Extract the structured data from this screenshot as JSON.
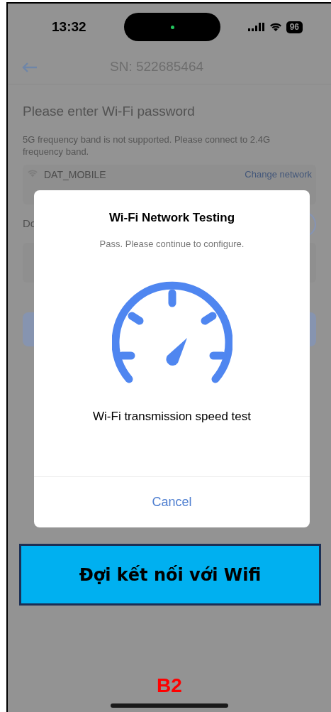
{
  "status_bar": {
    "time": "13:32",
    "battery": "96"
  },
  "header": {
    "title": "SN: 522685464"
  },
  "page": {
    "heading": "Please enter Wi-Fi password",
    "note": "5G frequency band is not supported. Please connect to 2.4G frequency band.",
    "network": "DAT_MOBILE",
    "change_link": "Change network",
    "row_label": "Do"
  },
  "dialog": {
    "title": "Wi-Fi Network Testing",
    "subtitle": "Pass. Please continue to configure.",
    "caption": "Wi-Fi transmission speed test",
    "buttons": [
      "Cancel"
    ]
  },
  "annotation": {
    "banner": "Đợi kết nối với Wifi",
    "step": "B2"
  }
}
